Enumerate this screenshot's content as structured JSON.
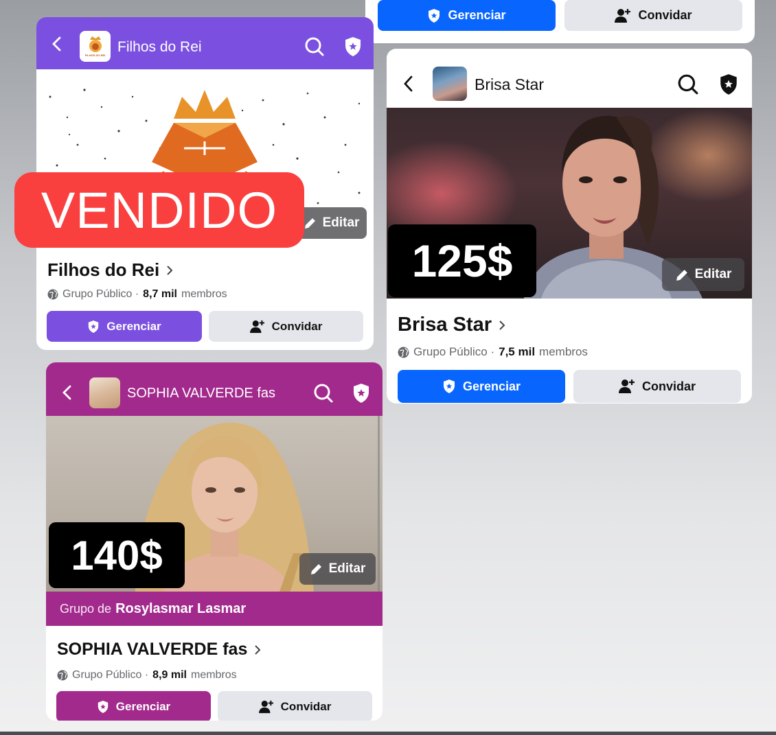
{
  "top_card": {
    "manage_label": "Gerenciar",
    "invite_label": "Convidar"
  },
  "filhos": {
    "header_title": "Filhos do Rei",
    "logo_text": "FILHOS DO REI",
    "edit_label": "Editar",
    "group_name": "Filhos do Rei",
    "privacy": "Grupo Público ·",
    "members_count": "8,7 mil",
    "members_word": "membros",
    "manage_label": "Gerenciar",
    "invite_label": "Convidar",
    "accent": "#7b50e0"
  },
  "brisa": {
    "header_title": "Brisa Star",
    "edit_label": "Editar",
    "price": "125$",
    "group_name": "Brisa Star",
    "privacy": "Grupo Público ·",
    "members_count": "7,5 mil",
    "members_word": "membros",
    "manage_label": "Gerenciar",
    "invite_label": "Convidar",
    "accent": "#0866ff"
  },
  "sophia": {
    "header_title": "SOPHIA VALVERDE fas",
    "edit_label": "Editar",
    "price": "140$",
    "owner_prefix": "Grupo de",
    "owner_name": "Rosylasmar Lasmar",
    "group_name": "SOPHIA VALVERDE fas",
    "privacy": "Grupo Público ·",
    "members_count": "8,9 mil",
    "members_word": "membros",
    "manage_label": "Gerenciar",
    "invite_label": "Convidar",
    "accent": "#a32a8d"
  },
  "overlay": {
    "sold_label": "VENDIDO"
  }
}
